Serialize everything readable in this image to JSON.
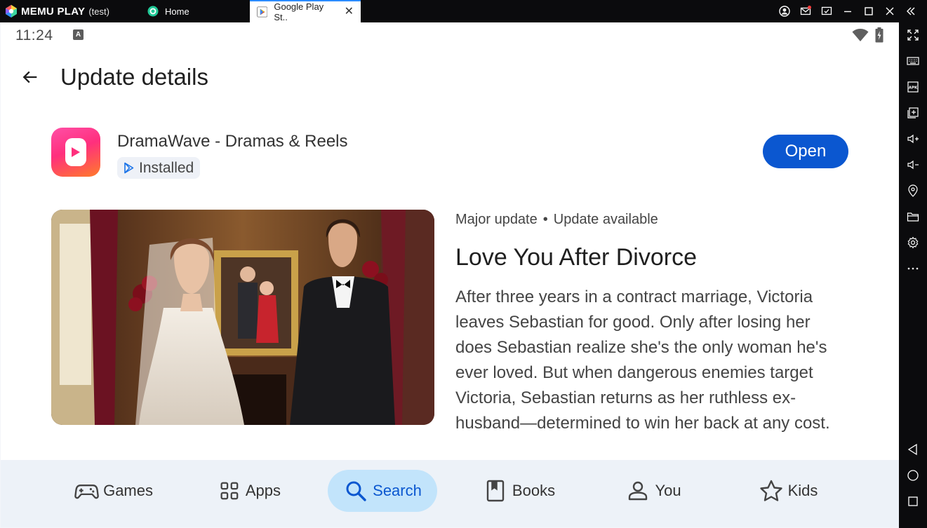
{
  "emulator": {
    "brand": "MEMU PLAY",
    "brand_suffix": "(test)",
    "tabs": [
      {
        "label": "Home"
      },
      {
        "label": "Google Play St.."
      }
    ]
  },
  "status_bar": {
    "time": "11:24",
    "badge": "A"
  },
  "app_bar": {
    "title": "Update details"
  },
  "app": {
    "name": "DramaWave - Dramas & Reels",
    "installed_label": "Installed",
    "open_label": "Open"
  },
  "update": {
    "tag1": "Major update",
    "separator": "•",
    "tag2": "Update available",
    "title": "Love You After Divorce",
    "description": "After three years in a contract marriage, Victoria leaves Sebastian for good. Only after losing her does Sebastian realize she's the only woman he's ever loved. But when dangerous enemies target Victoria, Sebastian returns as her ruthless ex-husband—determined to win her back at any cost."
  },
  "bottom_nav": {
    "items": [
      {
        "label": "Games",
        "icon": "gamepad-icon"
      },
      {
        "label": "Apps",
        "icon": "apps-grid-icon"
      },
      {
        "label": "Search",
        "icon": "search-icon",
        "active": true
      },
      {
        "label": "Books",
        "icon": "book-icon"
      },
      {
        "label": "You",
        "icon": "person-icon"
      },
      {
        "label": "Kids",
        "icon": "star-icon"
      }
    ]
  },
  "colors": {
    "primary": "#0b57d0",
    "active_nav_bg": "#c2e4fb",
    "nav_bg": "#edf2f8",
    "emulator_chrome": "#0b0b0d"
  }
}
